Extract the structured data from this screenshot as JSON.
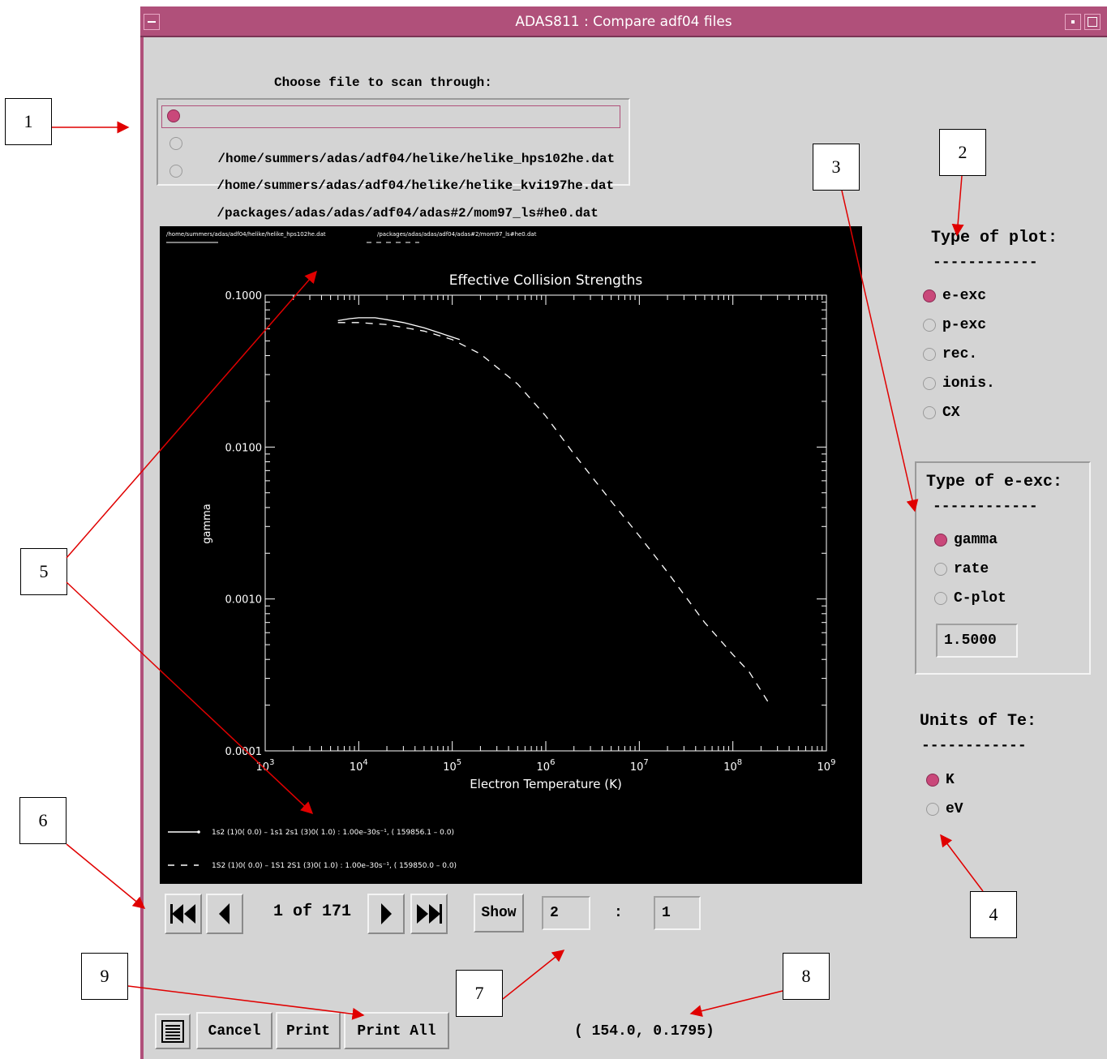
{
  "window": {
    "title": "ADAS811 : Compare adf04 files"
  },
  "file_chooser": {
    "label": "Choose file to scan through:",
    "files": [
      {
        "path": "/home/summers/adas/adf04/helike/helike_hps102he.dat",
        "selected": true
      },
      {
        "path": "/home/summers/adas/adf04/helike/helike_kvi197he.dat",
        "selected": false
      },
      {
        "path": "/packages/adas/adas/adf04/adas#2/mom97_ls#he0.dat",
        "selected": false
      }
    ]
  },
  "plot_type": {
    "label": "Type of plot:",
    "separator": "------------",
    "options": [
      {
        "label": "e-exc",
        "selected": true
      },
      {
        "label": "p-exc",
        "selected": false
      },
      {
        "label": "rec.",
        "selected": false
      },
      {
        "label": "ionis.",
        "selected": false
      },
      {
        "label": "CX",
        "selected": false
      }
    ]
  },
  "eexc_type": {
    "label": "Type of e-exc:",
    "separator": "------------",
    "options": [
      {
        "label": "gamma",
        "selected": true
      },
      {
        "label": "rate",
        "selected": false
      },
      {
        "label": "C-plot",
        "selected": false
      }
    ],
    "c_value": "1.5000"
  },
  "te_units": {
    "label": "Units of Te:",
    "separator": "------------",
    "options": [
      {
        "label": "K",
        "selected": true
      },
      {
        "label": "eV",
        "selected": false
      }
    ]
  },
  "navigation": {
    "counter": "1 of 171",
    "show_label": "Show",
    "upper_level": "2",
    "separator": ":",
    "lower_level": "1"
  },
  "footer": {
    "cancel_label": "Cancel",
    "print_label": "Print",
    "print_all_label": "Print All",
    "cursor_readout": "( 154.0, 0.1795)"
  },
  "callouts": [
    "1",
    "2",
    "3",
    "4",
    "5",
    "6",
    "7",
    "8",
    "9"
  ],
  "chart_data": {
    "type": "line",
    "title": "Effective Collision Strengths",
    "xlabel": "Electron Temperature (K)",
    "ylabel": "gamma",
    "x_scale": "log",
    "y_scale": "log",
    "xlim": [
      1000,
      1000000000
    ],
    "ylim": [
      0.0001,
      0.1
    ],
    "x_ticks": [
      "10^3",
      "10^4",
      "10^5",
      "10^6",
      "10^7",
      "10^8",
      "10^9"
    ],
    "y_ticks": [
      "0.1000",
      "0.0100",
      "0.0010",
      "0.0001"
    ],
    "file_headers": [
      "/home/summers/adas/adf04/helike/helike_hps102he.dat",
      "/packages/adas/adas/adf04/adas#2/mom97_ls#he0.dat"
    ],
    "legend": [
      "1s2 (1)0( 0.0) – 1s1 2s1 (3)0( 1.0) : 1.00e–30s⁻¹, ( 159856.1 – 0.0)",
      "1S2 (1)0( 0.0) – 1S1 2S1 (3)0( 1.0) : 1.00e–30s⁻¹, ( 159850.0 – 0.0)"
    ],
    "series": [
      {
        "style": "solid",
        "x": [
          6000,
          8000,
          10000,
          15000,
          20000,
          30000,
          50000,
          70000,
          100000,
          120000
        ],
        "y": [
          0.068,
          0.07,
          0.071,
          0.071,
          0.069,
          0.066,
          0.061,
          0.057,
          0.053,
          0.051
        ]
      },
      {
        "style": "dashed",
        "x": [
          6000,
          10000,
          20000,
          50000,
          100000,
          200000,
          500000,
          1000000,
          2000000,
          5000000,
          10000000,
          20000000,
          50000000,
          100000000,
          150000000,
          250000000
        ],
        "y": [
          0.066,
          0.066,
          0.064,
          0.058,
          0.051,
          0.041,
          0.026,
          0.016,
          0.009,
          0.0044,
          0.0026,
          0.0015,
          0.0007,
          0.00043,
          0.00033,
          0.0002
        ]
      }
    ]
  }
}
